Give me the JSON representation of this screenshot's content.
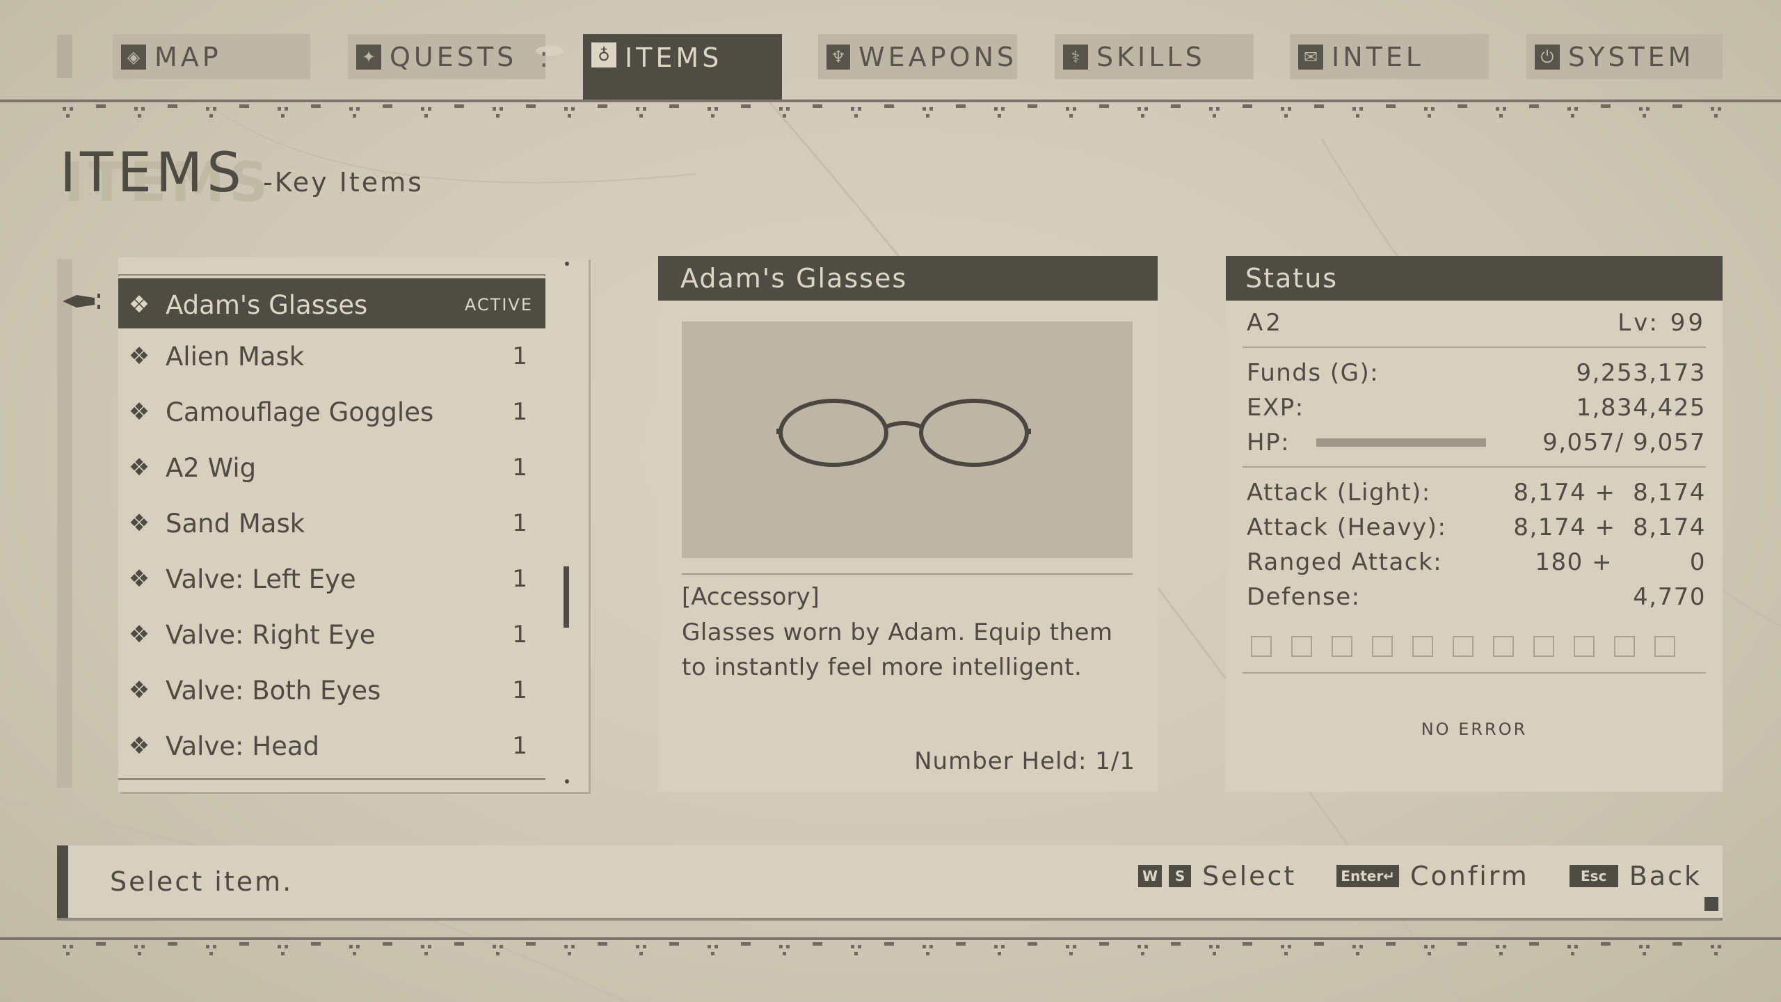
{
  "nav": {
    "tabs": [
      {
        "label": "MAP",
        "icon": "map-icon",
        "active": false
      },
      {
        "label": "QUESTS",
        "icon": "quests-icon",
        "active": false
      },
      {
        "label": "ITEMS",
        "icon": "items-icon",
        "active": true
      },
      {
        "label": "WEAPONS",
        "icon": "weapons-icon",
        "active": false
      },
      {
        "label": "SKILLS",
        "icon": "skills-icon",
        "active": false
      },
      {
        "label": "INTEL",
        "icon": "intel-icon",
        "active": false
      },
      {
        "label": "SYSTEM",
        "icon": "system-icon",
        "active": false
      }
    ]
  },
  "page": {
    "title": "ITEMS",
    "subtitle": "-Key Items"
  },
  "item_list": {
    "items": [
      {
        "name": "Adam's Glasses",
        "qty": "ACTIVE",
        "selected": true
      },
      {
        "name": "Alien Mask",
        "qty": "1"
      },
      {
        "name": "Camouflage Goggles",
        "qty": "1"
      },
      {
        "name": "A2 Wig",
        "qty": "1"
      },
      {
        "name": "Sand Mask",
        "qty": "1"
      },
      {
        "name": "Valve: Left Eye",
        "qty": "1"
      },
      {
        "name": "Valve: Right Eye",
        "qty": "1"
      },
      {
        "name": "Valve: Both Eyes",
        "qty": "1"
      },
      {
        "name": "Valve: Head",
        "qty": "1"
      }
    ]
  },
  "detail": {
    "title": "Adam's Glasses",
    "image_icon": "glasses-icon",
    "category": "[Accessory]",
    "description_line1": "Glasses worn by Adam. Equip them",
    "description_line2": "to instantly feel more intelligent.",
    "held": "Number Held: 1/1"
  },
  "status": {
    "header": "Status",
    "character": "A2",
    "level": "Lv: 99",
    "funds_label": "Funds (G):",
    "funds": "9,253,173",
    "exp_label": "EXP:",
    "exp": "1,834,425",
    "hp_label": "HP:",
    "hp": "9,057/ 9,057",
    "hp_fraction": 1.0,
    "attack_light_label": "Attack (Light):",
    "attack_light": "8,174 +  8,174",
    "attack_heavy_label": "Attack (Heavy):",
    "attack_heavy": "8,174 +  8,174",
    "ranged_label": "Ranged Attack:",
    "ranged": "180 +         0",
    "defense_label": "Defense:",
    "defense": "4,770",
    "chip_slots": 11,
    "error_text": "NO ERROR"
  },
  "bottom_bar": {
    "hint": "Select item.",
    "key_w": "W",
    "key_s": "S",
    "select_label": "Select",
    "key_enter": "Enter↵",
    "confirm_label": "Confirm",
    "key_esc": "Esc",
    "back_label": "Back"
  },
  "colors": {
    "background": "#cdc8b6",
    "panel": "#d6d1be",
    "dark": "#4f4c44",
    "text": "#4e4b43",
    "light_text": "#dcd7c5"
  }
}
